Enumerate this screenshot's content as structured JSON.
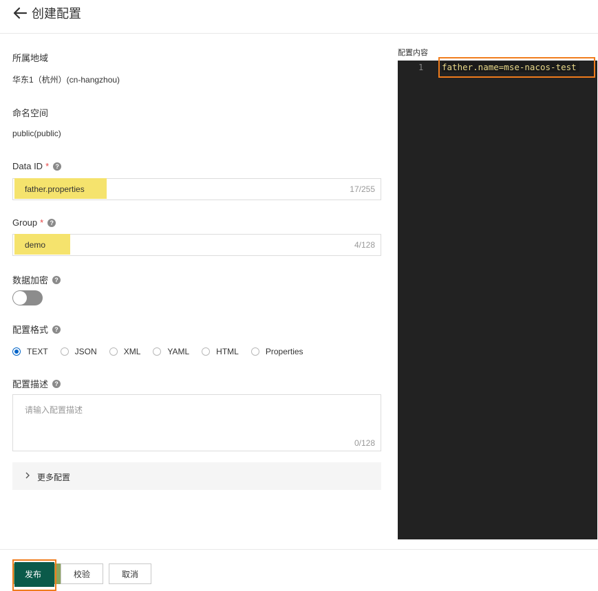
{
  "header": {
    "title": "创建配置"
  },
  "region": {
    "label": "所属地域",
    "value": "华东1（杭州）(cn-hangzhou)"
  },
  "namespace": {
    "label": "命名空间",
    "value": "public(public)"
  },
  "data_id": {
    "label": "Data ID",
    "required": "*",
    "value": "father.properties",
    "counter": "17/255"
  },
  "group": {
    "label": "Group",
    "required": "*",
    "value": "demo",
    "counter": "4/128"
  },
  "encryption": {
    "label": "数据加密",
    "enabled": false
  },
  "format": {
    "label": "配置格式",
    "options": [
      "TEXT",
      "JSON",
      "XML",
      "YAML",
      "HTML",
      "Properties"
    ],
    "selected": "TEXT"
  },
  "description": {
    "label": "配置描述",
    "placeholder": "请输入配置描述",
    "counter": "0/128"
  },
  "more": {
    "label": "更多配置"
  },
  "editor": {
    "label": "配置内容",
    "line_number": "1",
    "content": "father.name=mse-nacos-test"
  },
  "footer": {
    "publish": "发布",
    "validate": "校验",
    "cancel": "取消"
  },
  "colors": {
    "primary": "#0b5a4a",
    "highlight": "#f5e36d",
    "annotation": "#f07c1c",
    "editor_bg": "#222222",
    "radio_checked": "#0064c8"
  }
}
